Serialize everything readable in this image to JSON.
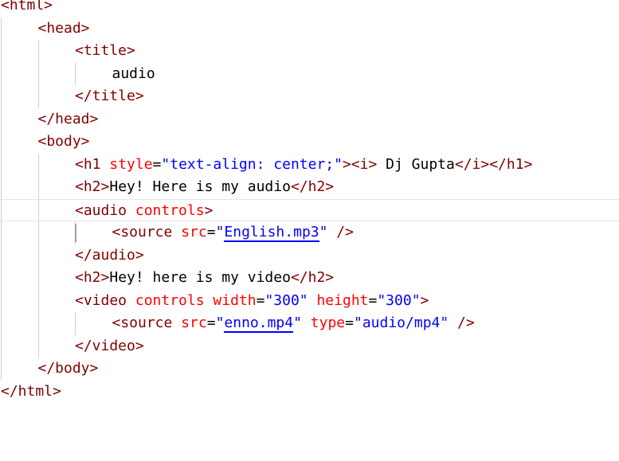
{
  "editor": {
    "colors": {
      "tag": "#800000",
      "attribute": "#ff0000",
      "value": "#0000ff",
      "text": "#000000",
      "indent_guide": "#d0d0d0",
      "current_line_border": "#e6e6e6"
    },
    "lines": [
      {
        "indent": 0,
        "tokens": [
          {
            "t": "tag",
            "v": "<html>"
          }
        ]
      },
      {
        "indent": 1,
        "tokens": [
          {
            "t": "tag",
            "v": "<head>"
          }
        ]
      },
      {
        "indent": 2,
        "tokens": [
          {
            "t": "tag",
            "v": "<title>"
          }
        ]
      },
      {
        "indent": 3,
        "tokens": [
          {
            "t": "txt",
            "v": "audio"
          }
        ]
      },
      {
        "indent": 2,
        "tokens": [
          {
            "t": "tag",
            "v": "</title>"
          }
        ]
      },
      {
        "indent": 1,
        "tokens": [
          {
            "t": "tag",
            "v": "</head>"
          }
        ]
      },
      {
        "indent": 1,
        "tokens": [
          {
            "t": "tag",
            "v": "<body>"
          }
        ]
      },
      {
        "indent": 2,
        "tokens": [
          {
            "t": "tag",
            "v": "<h1 "
          },
          {
            "t": "attr",
            "v": "style"
          },
          {
            "t": "txt",
            "v": "="
          },
          {
            "t": "val",
            "v": "\"text-align: center;\""
          },
          {
            "t": "tag",
            "v": "><i>"
          },
          {
            "t": "txt",
            "v": " Dj Gupta"
          },
          {
            "t": "tag",
            "v": "</i></h1>"
          }
        ]
      },
      {
        "indent": 2,
        "tokens": [
          {
            "t": "tag",
            "v": "<h2>"
          },
          {
            "t": "txt",
            "v": "Hey! Here is my audio"
          },
          {
            "t": "tag",
            "v": "</h2>"
          }
        ]
      },
      {
        "indent": 2,
        "current": true,
        "tokens": [
          {
            "t": "tag",
            "v": "<audio "
          },
          {
            "t": "attr",
            "v": "controls"
          },
          {
            "t": "tag",
            "v": ">"
          }
        ]
      },
      {
        "indent": 3,
        "tokens": [
          {
            "t": "tag",
            "v": "<source "
          },
          {
            "t": "attr",
            "v": "src"
          },
          {
            "t": "txt",
            "v": "="
          },
          {
            "t": "val",
            "v": "\""
          },
          {
            "t": "link",
            "v": "English.mp3"
          },
          {
            "t": "val",
            "v": "\""
          },
          {
            "t": "tag",
            "v": " />"
          }
        ]
      },
      {
        "indent": 2,
        "tokens": [
          {
            "t": "tag",
            "v": "</audio>"
          }
        ]
      },
      {
        "indent": 2,
        "tokens": [
          {
            "t": "tag",
            "v": "<h2>"
          },
          {
            "t": "txt",
            "v": "Hey! here is my video"
          },
          {
            "t": "tag",
            "v": "</h2>"
          }
        ]
      },
      {
        "indent": 2,
        "tokens": [
          {
            "t": "tag",
            "v": "<video "
          },
          {
            "t": "attr",
            "v": "controls"
          },
          {
            "t": "tag",
            "v": " "
          },
          {
            "t": "attr",
            "v": "width"
          },
          {
            "t": "txt",
            "v": "="
          },
          {
            "t": "val",
            "v": "\"300\""
          },
          {
            "t": "tag",
            "v": " "
          },
          {
            "t": "attr",
            "v": "height"
          },
          {
            "t": "txt",
            "v": "="
          },
          {
            "t": "val",
            "v": "\"300\""
          },
          {
            "t": "tag",
            "v": ">"
          }
        ]
      },
      {
        "indent": 3,
        "tokens": [
          {
            "t": "tag",
            "v": "<source "
          },
          {
            "t": "attr",
            "v": "src"
          },
          {
            "t": "txt",
            "v": "="
          },
          {
            "t": "val",
            "v": "\""
          },
          {
            "t": "link",
            "v": "enno.mp4"
          },
          {
            "t": "val",
            "v": "\""
          },
          {
            "t": "tag",
            "v": " "
          },
          {
            "t": "attr",
            "v": "type"
          },
          {
            "t": "txt",
            "v": "="
          },
          {
            "t": "val",
            "v": "\"audio/mp4\""
          },
          {
            "t": "tag",
            "v": " />"
          }
        ]
      },
      {
        "indent": 2,
        "tokens": [
          {
            "t": "tag",
            "v": "</video>"
          }
        ]
      },
      {
        "indent": 1,
        "tokens": [
          {
            "t": "tag",
            "v": "</body>"
          }
        ]
      },
      {
        "indent": 0,
        "tokens": [
          {
            "t": "tag",
            "v": "</html>"
          }
        ]
      }
    ]
  }
}
